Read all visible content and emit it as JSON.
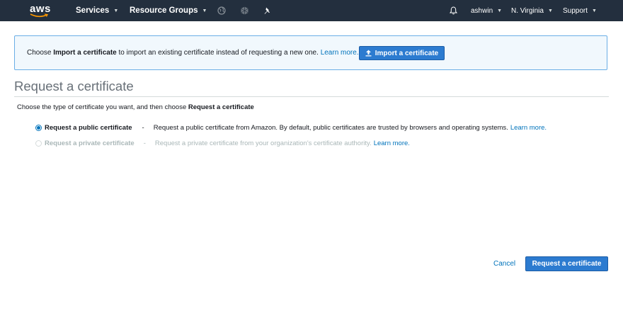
{
  "nav": {
    "logo": "aws",
    "services": "Services",
    "resource_groups": "Resource Groups",
    "user": "ashwin",
    "region": "N. Virginia",
    "support": "Support",
    "icons": [
      "globe-icon",
      "gear-icon",
      "pin-icon",
      "bell-icon"
    ]
  },
  "banner": {
    "text_prefix": "Choose ",
    "text_bold": "Import a certificate",
    "text_suffix": " to import an existing certificate instead of requesting a new one. ",
    "learn_more": "Learn more.",
    "button_label": "Import a certificate",
    "button_icon": "upload-icon"
  },
  "page": {
    "title": "Request a certificate",
    "subtitle_prefix": "Choose the type of certificate you want, and then choose ",
    "subtitle_bold": "Request a certificate"
  },
  "options": [
    {
      "label": "Request a public certificate",
      "dash": "-",
      "description": "Request a public certificate from Amazon. By default, public certificates are trusted by browsers and operating systems.",
      "learn_more": "Learn more.",
      "selected": true,
      "enabled": true
    },
    {
      "label": "Request a private certificate",
      "dash": "-",
      "description": "Request a private certificate from your organization's certificate authority.",
      "learn_more": "Learn more.",
      "selected": false,
      "enabled": false
    }
  ],
  "footer": {
    "cancel": "Cancel",
    "submit": "Request a certificate"
  },
  "colors": {
    "nav_bg": "#232f3e",
    "accent": "#0073bb",
    "primary_button": "#2c7bd0",
    "banner_bg": "#f1f8fd",
    "banner_border": "#6aaee6"
  }
}
